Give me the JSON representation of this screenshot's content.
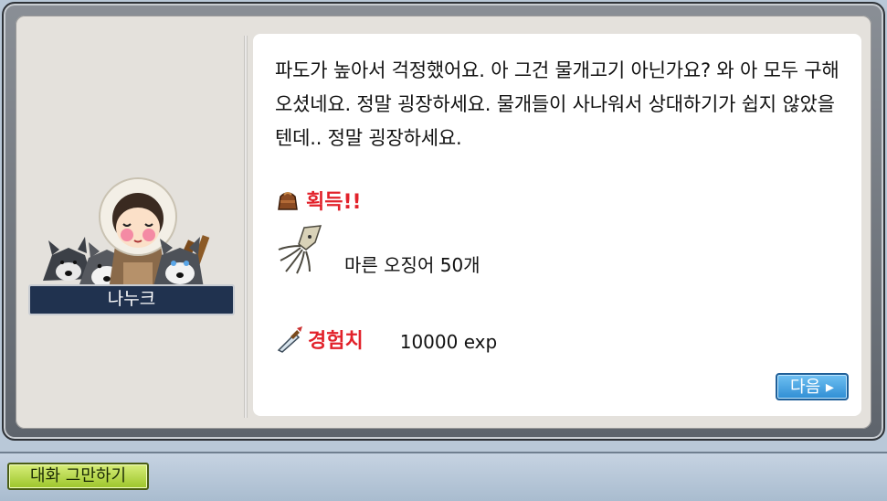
{
  "npc": {
    "name": "나누크"
  },
  "dialog": {
    "text": "파도가 높아서 걱정했어요. 아 그건 물개고기 아닌가요? 와 아 모두 구해오셨네요. 정말 굉장하세요. 물개들이 사나워서 상대하기가 쉽지 않았을텐데.. 정말 굉장하세요."
  },
  "rewards": {
    "obtain_label": "획득!!",
    "item_name": "마른 오징어 50개",
    "exp_label": "경험치",
    "exp_value": "10000 exp"
  },
  "buttons": {
    "next": "다음 ▸",
    "end_chat": "대화 그만하기"
  },
  "colors": {
    "label_red": "#e2222b",
    "name_plate": "#20324f",
    "next_button": "#2f8ed4",
    "end_button": "#9cc52a"
  },
  "icons": {
    "obtain": "bag-icon",
    "item": "dried-squid-icon",
    "exp": "sword-icon"
  }
}
